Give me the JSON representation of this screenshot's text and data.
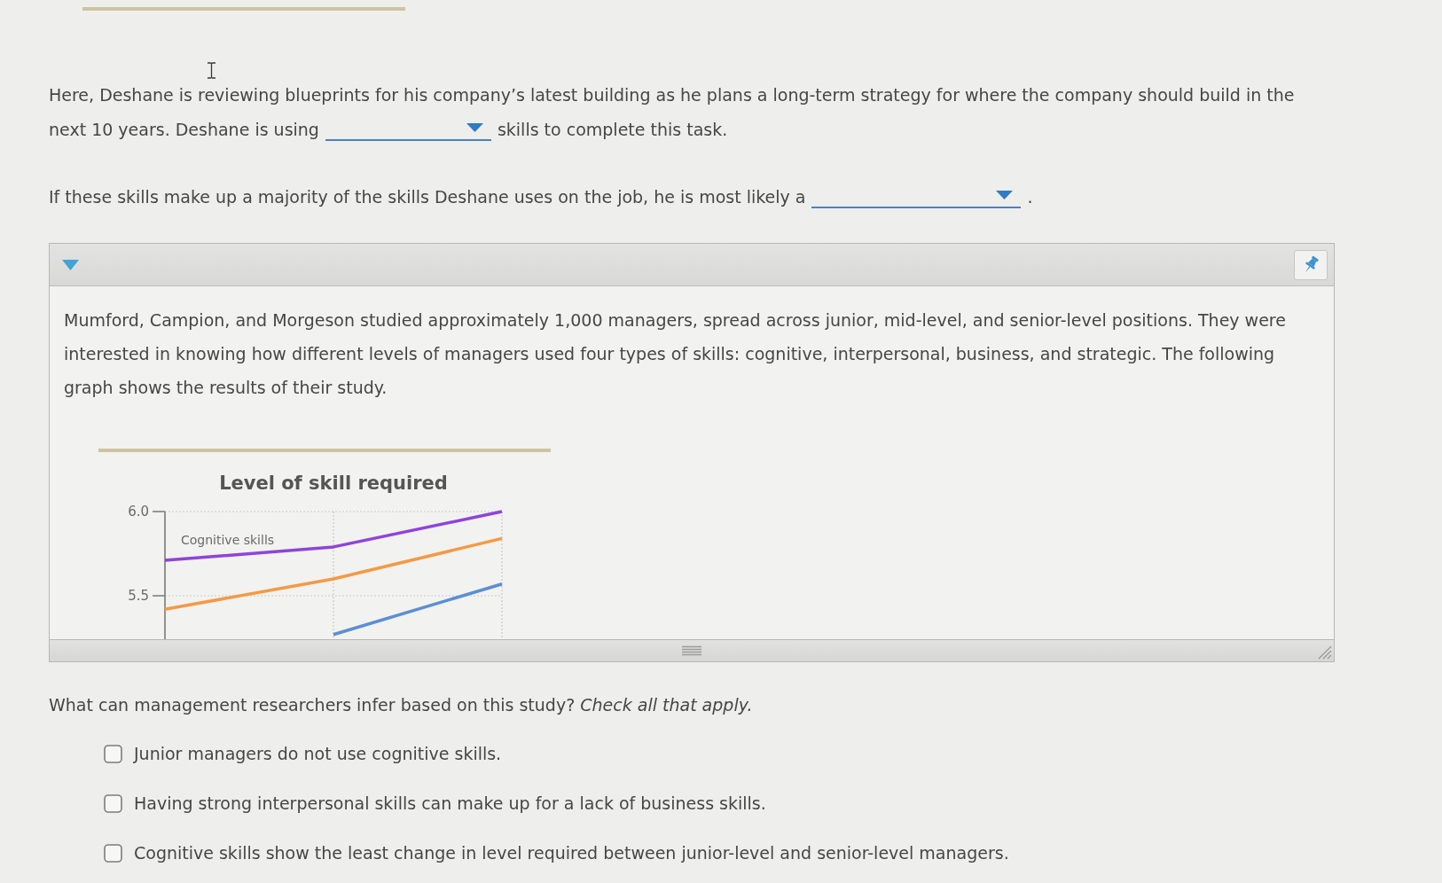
{
  "questions": [
    {
      "parts": [
        {
          "kind": "text",
          "text": "Here, Deshane is reviewing blueprints for his company’s latest building as he plans a long-term strategy for where the company should build in the"
        },
        {
          "kind": "text",
          "text": "next 10 years. Deshane is using"
        },
        {
          "kind": "dropdown"
        },
        {
          "kind": "text",
          "text": "skills to complete this task."
        }
      ]
    },
    {
      "parts": [
        {
          "kind": "text",
          "text": "If these skills make up a majority of the skills Deshane uses on the job, he is most likely a"
        },
        {
          "kind": "dropdown"
        },
        {
          "kind": "text",
          "text": "."
        }
      ]
    }
  ],
  "panel": {
    "expanded": true,
    "text": "Mumford, Campion, and Morgeson studied approximately 1,000 managers, spread across junior, mid-level, and senior-level positions. They were interested in knowing how different levels of managers used four types of skills: cognitive, interpersonal, business, and strategic. The following graph shows the results of their study.",
    "chart_data": {
      "type": "line",
      "title": "Level of skill required",
      "ylim": [
        5.25,
        6.0
      ],
      "yticks": [
        {
          "value": 5.5,
          "label": "5.5"
        },
        {
          "value": 6.0,
          "label": "6.0"
        }
      ],
      "series": [
        {
          "name": "Cognitive skills",
          "color": "#8e44dc",
          "values": [
            5.71,
            5.79,
            6.0
          ]
        },
        {
          "color": "#f39a45",
          "values": [
            5.42,
            5.6,
            5.84
          ]
        },
        {
          "color": "#5b8fd1",
          "values": [
            null,
            5.27,
            5.57
          ]
        }
      ]
    }
  },
  "prompt": "What can management researchers infer based on this study? *Check all that apply.*",
  "options": [
    {
      "label": "Junior managers do not use cognitive skills.",
      "checked": false
    },
    {
      "label": "Having strong interpersonal skills can make up for a lack of business skills.",
      "checked": false
    },
    {
      "label": "Cognitive skills show the least change in level required between junior-level and senior-level managers.",
      "checked": false
    }
  ]
}
